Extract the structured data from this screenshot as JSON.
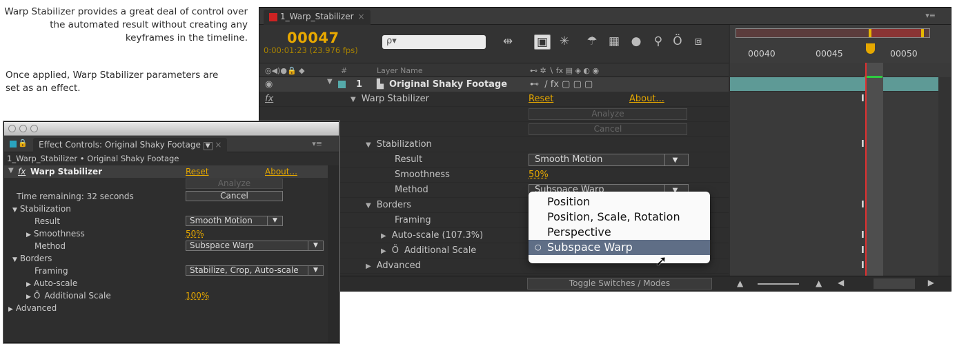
{
  "captions": {
    "top": "Warp Stabilizer provides a great deal of control over the automated result without creating any keyframes in the timeline.",
    "middle": "Once applied, Warp Stabilizer parameters are set as an effect."
  },
  "timeline": {
    "tab_label": "1_Warp_Stabilizer",
    "tab_close": "×",
    "timecode": "00047",
    "timecode_sub": "0:00:01:23 (23.976 fps)",
    "search_placeholder": "ρ▾",
    "ruler_labels": [
      "00040",
      "00045",
      "00050"
    ],
    "col_num": "#",
    "col_layer_name": "Layer Name",
    "layer": {
      "num": "1",
      "name": "Original Shaky Footage"
    },
    "effect_name": "Warp Stabilizer",
    "reset": "Reset",
    "about": "About...",
    "analyze": "Analyze",
    "cancel": "Cancel",
    "stabilization": "Stabilization",
    "result_label": "Result",
    "result_value": "Smooth Motion",
    "smoothness_label": "Smoothness",
    "smoothness_value": "50%",
    "method_label": "Method",
    "method_value": "Subspace Warp",
    "borders": "Borders",
    "framing": "Framing",
    "autoscale": "Auto-scale (107.3%)",
    "additional_scale": "Additional Scale",
    "advanced": "Advanced",
    "toggle": "Toggle Switches / Modes",
    "fx": "fx"
  },
  "popup": {
    "items": [
      "Position",
      "Position, Scale, Rotation",
      "Perspective",
      "Subspace Warp"
    ],
    "selected": "Subspace Warp"
  },
  "effect_controls": {
    "tab_label": "Effect Controls: Original Shaky Footage",
    "path": "1_Warp_Stabilizer • Original Shaky Footage",
    "effect_name": "Warp Stabilizer",
    "reset": "Reset",
    "about": "About...",
    "analyze": "Analyze",
    "time_remaining": "Time remaining: 32 seconds",
    "cancel": "Cancel",
    "stabilization": "Stabilization",
    "result_label": "Result",
    "result_value": "Smooth Motion",
    "smoothness_label": "Smoothness",
    "smoothness_value": "50%",
    "method_label": "Method",
    "method_value": "Subspace Warp",
    "borders": "Borders",
    "framing_label": "Framing",
    "framing_value": "Stabilize, Crop, Auto-scale",
    "autoscale": "Auto-scale",
    "additional_scale_label": "Additional Scale",
    "additional_scale_value": "100%",
    "advanced": "Advanced"
  },
  "colors": {
    "accent": "#e6a800",
    "cti": "#e03030",
    "menu_sel": "#5f6e86"
  }
}
